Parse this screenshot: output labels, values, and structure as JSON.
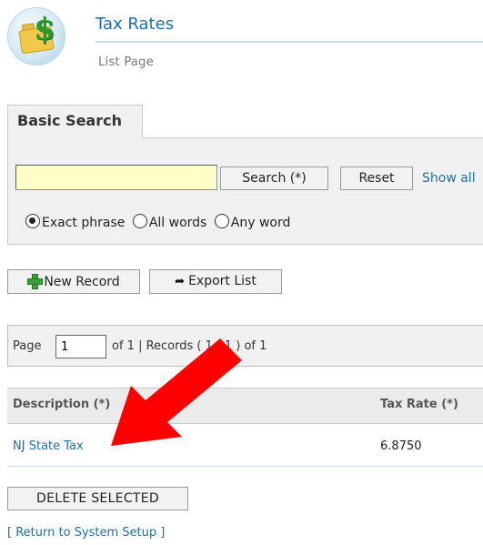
{
  "header": {
    "title": "Tax Rates",
    "subtitle": "List Page",
    "logo_icon": "folder-dollar-icon"
  },
  "search": {
    "tab_label": "Basic Search",
    "input_value": "",
    "search_button": "Search (*)",
    "reset_button": "Reset",
    "show_all_link": "Show all",
    "options": [
      "Exact phrase",
      "All words",
      "Any word"
    ],
    "selected_option": "Exact phrase"
  },
  "toolbar": {
    "new_record": "New Record",
    "export_list": "Export List"
  },
  "pager": {
    "page_label": "Page",
    "page_value": "1",
    "info": "of  1 | Records ( 1 - 1 ) of 1"
  },
  "table": {
    "columns": [
      "Description (*)",
      "Tax Rate (*)"
    ],
    "rows": [
      {
        "description": "NJ State Tax",
        "rate": "6.8750"
      }
    ]
  },
  "actions": {
    "delete_selected": "DELETE SELECTED",
    "return_link": "[ Return to System Setup ]"
  },
  "colors": {
    "link": "#1e6fa8",
    "panel": "#f1f1f1",
    "input_highlight": "#ffffc8",
    "annotation_arrow": "#ff0000"
  }
}
